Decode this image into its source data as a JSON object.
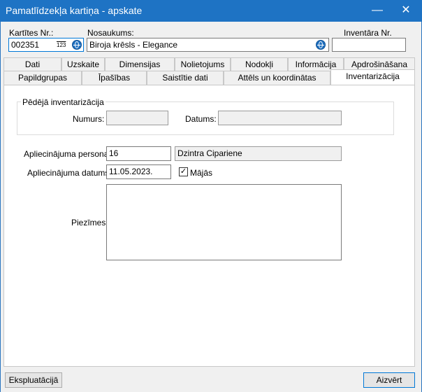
{
  "window": {
    "title": "Pamatlīdzekļa kartiņa - apskate",
    "minimize": "—",
    "close": "✕"
  },
  "header": {
    "card_no_label": "Kartītes Nr.:",
    "card_no_value": "002351",
    "numbering_icon_text": "123",
    "name_label": "Nosaukums:",
    "name_value": "Biroja krēsls - Elegance",
    "inventory_no_label": "Inventāra Nr.",
    "inventory_no_value": ""
  },
  "tabs_row1": [
    "Dati",
    "Uzskaite",
    "Dimensijas",
    "Nolietojums",
    "Nodokļi",
    "Informācija",
    "Apdrošināšana"
  ],
  "tabs_row2": [
    "Papildgrupas",
    "Īpašības",
    "Saistītie dati",
    "Attēls un koordinātas",
    "Inventarizācija"
  ],
  "active_tab": "Inventarizācija",
  "last_inventory": {
    "group_title": "Pēdējā inventarizācija",
    "number_label": "Numurs:",
    "number_value": "",
    "date_label": "Datums:",
    "date_value": ""
  },
  "confirm": {
    "person_label": "Apliecinājuma persona:",
    "person_code": "16",
    "person_name": "Dzintra Cipariene",
    "date_label": "Apliecinājuma datums:",
    "date_value": "11.05.2023.",
    "at_home_label": "Mājās",
    "at_home_checked": true,
    "notes_label": "Piezīmes:",
    "notes_value": ""
  },
  "footer": {
    "exploitation_button": "Ekspluatācijā",
    "close_button": "Aizvērt"
  },
  "colors": {
    "titlebar": "#1e73c4",
    "accent": "#0078d7",
    "background": "#f0f0f0"
  }
}
